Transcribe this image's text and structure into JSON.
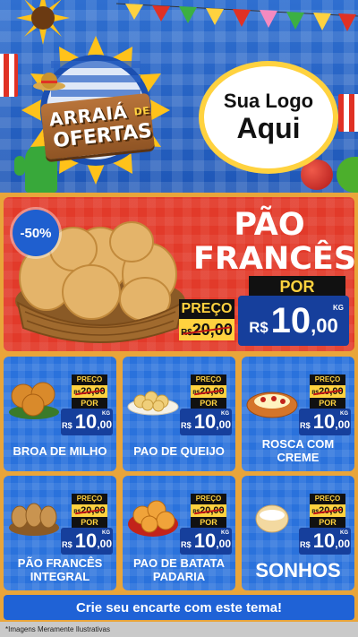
{
  "header": {
    "badge_line1": "ARRAIÁ",
    "badge_line1_small": "DE",
    "badge_line2": "OFERTAS",
    "logo_line1": "Sua Logo",
    "logo_line2": "Aqui"
  },
  "featured": {
    "discount": "-50%",
    "title_line1": "PÃO",
    "title_line2": "FRANCÊS",
    "preco_label": "PREÇO",
    "old_currency": "R$",
    "old_price": "20,00",
    "por_label": "POR",
    "new_currency": "R$",
    "new_int": "10",
    "new_cents": ",00",
    "unit": "KG"
  },
  "products": [
    {
      "name": "BROA DE MILHO",
      "preco_label": "PREÇO",
      "old_currency": "R$",
      "old_price": "20,00",
      "por_label": "POR",
      "new_currency": "R$",
      "new_int": "10",
      "new_cents": ",00",
      "unit": "KG"
    },
    {
      "name": "PAO DE QUEIJO",
      "preco_label": "PREÇO",
      "old_currency": "R$",
      "old_price": "20,00",
      "por_label": "POR",
      "new_currency": "R$",
      "new_int": "10",
      "new_cents": ",00",
      "unit": "KG"
    },
    {
      "name": "ROSCA COM CREME",
      "preco_label": "PREÇO",
      "old_currency": "R$",
      "old_price": "20,00",
      "por_label": "POR",
      "new_currency": "R$",
      "new_int": "10",
      "new_cents": ",00",
      "unit": "KG"
    },
    {
      "name": "PÃO FRANCÊS INTEGRAL",
      "preco_label": "PREÇO",
      "old_currency": "R$",
      "old_price": "20,00",
      "por_label": "POR",
      "new_currency": "R$",
      "new_int": "10",
      "new_cents": ",00",
      "unit": "KG"
    },
    {
      "name": "PAO DE BATATA PADARIA",
      "preco_label": "PREÇO",
      "old_currency": "R$",
      "old_price": "20,00",
      "por_label": "POR",
      "new_currency": "R$",
      "new_int": "10",
      "new_cents": ",00",
      "unit": "KG"
    },
    {
      "name": "SONHOS",
      "preco_label": "PREÇO",
      "old_currency": "R$",
      "old_price": "20,00",
      "por_label": "POR",
      "new_currency": "R$",
      "new_int": "10",
      "new_cents": ",00",
      "unit": "KG"
    }
  ],
  "footer": {
    "cta": "Crie seu encarte com este tema!",
    "disclaimer": "*Imagens Meramente Ilustrativas"
  },
  "colors": {
    "background": "#e9a53a",
    "header_blue": "#2f6fd0",
    "featured_red": "#e23a2a",
    "card_blue": "#2a72dc",
    "price_navy": "#163f9c",
    "accent_yellow": "#ffd23f"
  },
  "icons": [
    "sun-icon",
    "bunting-flags",
    "popcorn-icon",
    "cactus-icon",
    "apple-icon",
    "straw-hat-icon"
  ]
}
